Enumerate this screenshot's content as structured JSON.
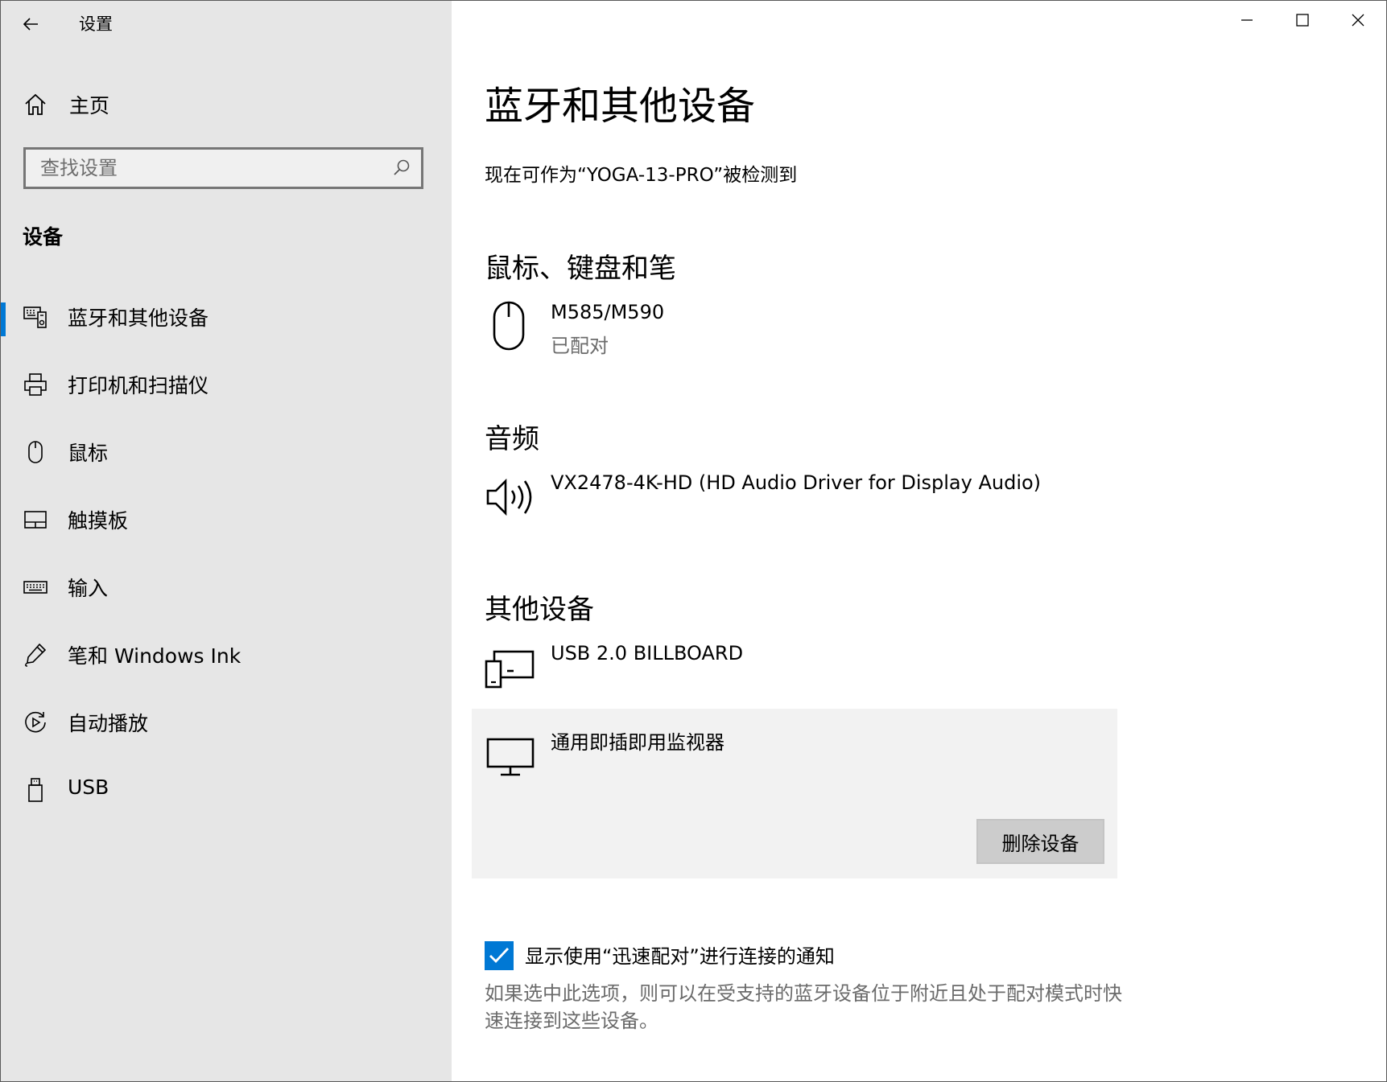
{
  "window": {
    "title": "设置",
    "controls": [
      "minimize",
      "maximize",
      "close"
    ]
  },
  "sidebar": {
    "home_label": "主页",
    "search_placeholder": "查找设置",
    "section_title": "设备",
    "items": [
      {
        "label": "蓝牙和其他设备",
        "icon": "bluetooth-devices-icon",
        "active": true
      },
      {
        "label": "打印机和扫描仪",
        "icon": "printer-icon",
        "active": false
      },
      {
        "label": "鼠标",
        "icon": "mouse-icon",
        "active": false
      },
      {
        "label": "触摸板",
        "icon": "touchpad-icon",
        "active": false
      },
      {
        "label": "输入",
        "icon": "keyboard-icon",
        "active": false
      },
      {
        "label": "笔和 Windows Ink",
        "icon": "pen-icon",
        "active": false
      },
      {
        "label": "自动播放",
        "icon": "autoplay-icon",
        "active": false
      },
      {
        "label": "USB",
        "icon": "usb-icon",
        "active": false
      }
    ]
  },
  "main": {
    "title": "蓝牙和其他设备",
    "discoverable_text": "现在可作为“YOGA-13-PRO”被检测到",
    "groups": {
      "input": {
        "title": "鼠标、键盘和笔",
        "devices": [
          {
            "name": "M585/M590",
            "status": "已配对",
            "icon": "mouse-icon"
          }
        ]
      },
      "audio": {
        "title": "音频",
        "devices": [
          {
            "name": "VX2478-4K-HD (HD Audio Driver for Display Audio)",
            "icon": "speaker-icon"
          }
        ]
      },
      "other": {
        "title": "其他设备",
        "devices": [
          {
            "name": "USB 2.0 BILLBOARD",
            "icon": "generic-device-icon"
          },
          {
            "name": "通用即插即用监视器",
            "icon": "monitor-icon",
            "selected": true
          }
        ]
      }
    },
    "remove_button": "删除设备",
    "swift_pair": {
      "label": "显示使用“迅速配对”进行连接的通知",
      "checked": true,
      "description": "如果选中此选项，则可以在受支持的蓝牙设备位于附近且处于配对模式时快速连接到这些设备。"
    }
  },
  "colors": {
    "accent": "#0078d4",
    "sidebar_bg": "#e6e6e6",
    "secondary_text": "#6b6b6b",
    "selected_card_bg": "#f2f2f2",
    "button_bg": "#cccccc"
  }
}
